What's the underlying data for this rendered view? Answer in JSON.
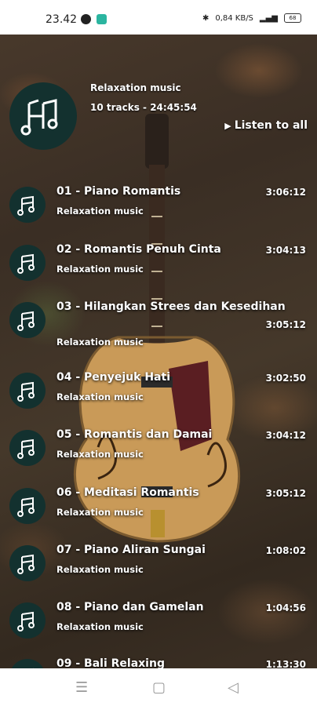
{
  "status": {
    "time": "23.42",
    "right_text": "0,84 KB/S",
    "battery": "68"
  },
  "header": {
    "title": "Relaxation music",
    "meta": "10 tracks - 24:45:54",
    "listen_all": "Listen to all"
  },
  "tracks": [
    {
      "title": "01 - Piano Romantis",
      "artist": "Relaxation music",
      "duration": "3:06:12"
    },
    {
      "title": "02 - Romantis Penuh Cinta",
      "artist": "Relaxation music",
      "duration": "3:04:13"
    },
    {
      "title": "03 - Hilangkan Strees dan Kesedihan",
      "artist": "Relaxation music",
      "duration": "3:05:12"
    },
    {
      "title": "04 - Penyejuk Hati",
      "artist": "Relaxation music",
      "duration": "3:02:50"
    },
    {
      "title": "05 - Romantis dan Damai",
      "artist": "Relaxation music",
      "duration": "3:04:12"
    },
    {
      "title": "06 - Meditasi Romantis",
      "artist": "Relaxation music",
      "duration": "3:05:12"
    },
    {
      "title": "07 - Piano Aliran Sungai",
      "artist": "Relaxation music",
      "duration": "1:08:02"
    },
    {
      "title": "08 - Piano dan Gamelan",
      "artist": "Relaxation music",
      "duration": "1:04:56"
    },
    {
      "title": "09 - Bali Relaxing",
      "artist": "",
      "duration": "1:13:30"
    }
  ],
  "icons": {
    "album": "music-note-logo-icon",
    "play": "play-icon",
    "nav": [
      "menu-icon",
      "home-square-icon",
      "back-triangle-icon"
    ]
  }
}
